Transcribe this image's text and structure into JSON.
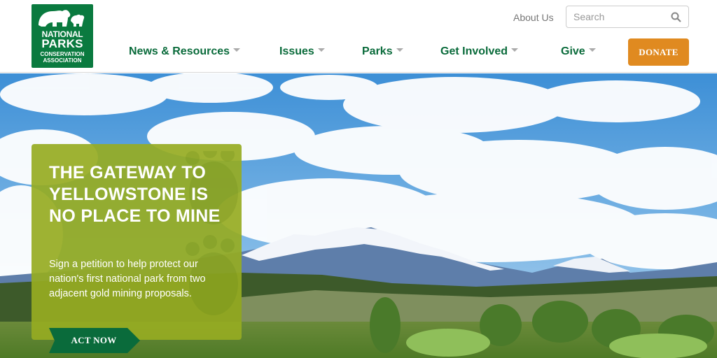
{
  "logo": {
    "line1": "NATIONAL",
    "line2": "PARKS",
    "line3": "CONSERVATION",
    "line4": "ASSOCIATION",
    "color": "#0a7a3f"
  },
  "header": {
    "about_link": "About Us",
    "search_placeholder": "Search",
    "donate_label": "DONATE",
    "donate_color": "#e08a20"
  },
  "nav": {
    "items": [
      {
        "label": "News & Resources"
      },
      {
        "label": "Issues"
      },
      {
        "label": "Parks"
      },
      {
        "label": "Get Involved"
      },
      {
        "label": "Give"
      }
    ]
  },
  "hero": {
    "title": "THE GATEWAY TO YELLOWSTONE IS NO PLACE TO MINE",
    "body": "Sign a petition to help protect our nation's first national park from two adjacent gold mining proposals.",
    "cta_label": "ACT NOW",
    "card_color": "#96ab22",
    "cta_color": "#0a6b3b"
  }
}
